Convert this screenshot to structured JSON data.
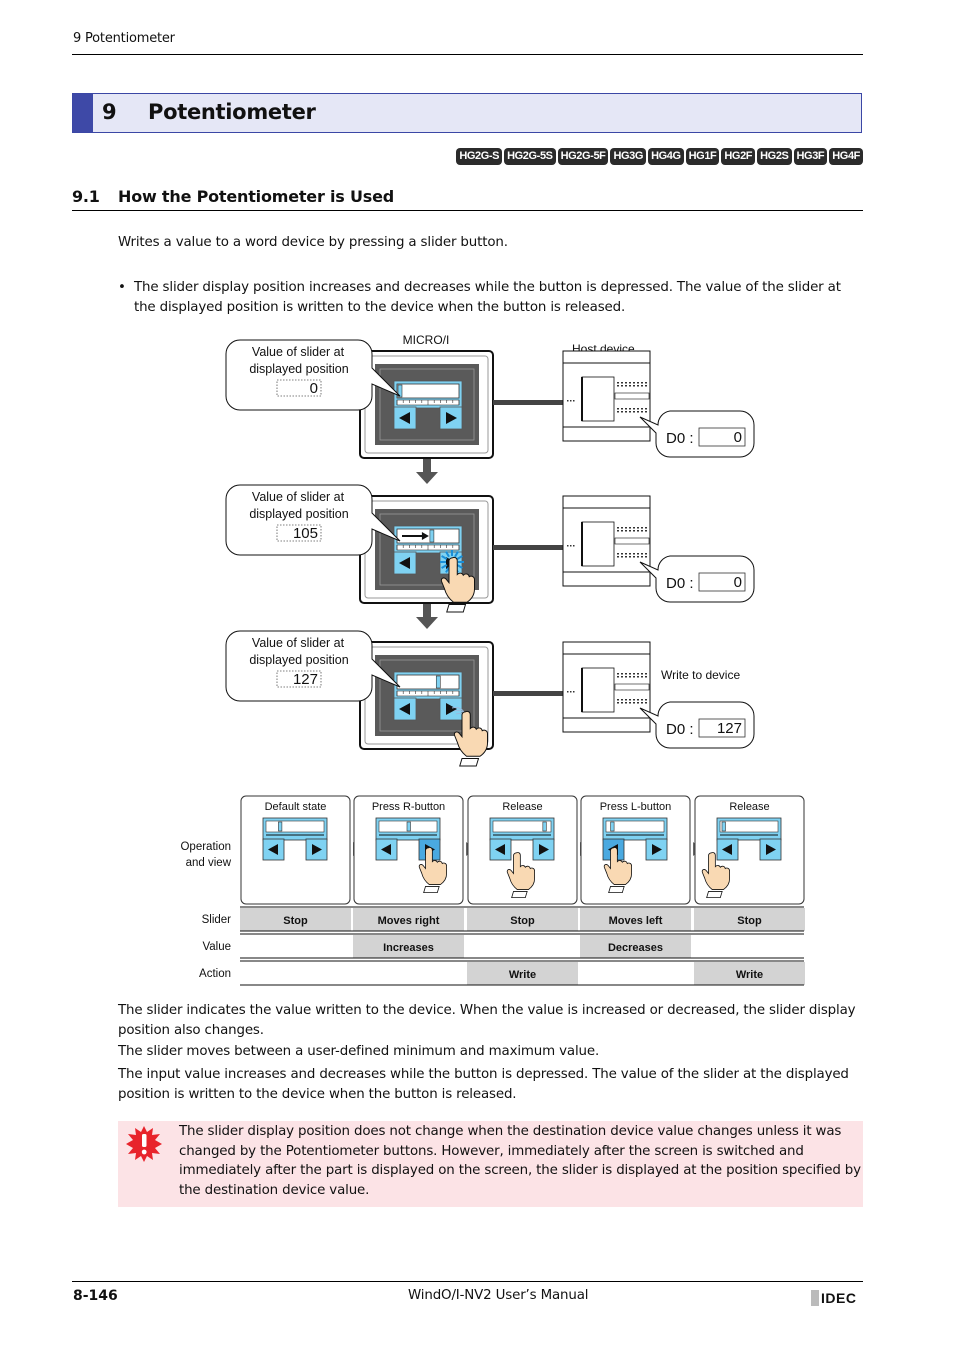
{
  "running_header": "9 Potentiometer",
  "chapter": {
    "number": "9",
    "title": "Potentiometer",
    "accent_color": "#3e49a7",
    "background_color": "#e5e7f6"
  },
  "models": [
    "HG2G-S",
    "HG2G-5S",
    "HG2G-5F",
    "HG3G",
    "HG4G",
    "HG1F",
    "HG2F",
    "HG2S",
    "HG3F",
    "HG4F"
  ],
  "section": {
    "number": "9.1",
    "title": "How the Potentiometer is Used"
  },
  "intro": "Writes a value to a word device by pressing a slider button.",
  "bullet": {
    "marker": "•",
    "text": "The slider display position increases and decreases while the button is depressed. The value of the slider at the displayed position is written to the device when the button is released."
  },
  "figure1": {
    "micro_label": "MICRO/I",
    "host_label": "Host device",
    "write_label": "Write to device",
    "steps": [
      {
        "callout": [
          "Value of slider at",
          "displayed position"
        ],
        "slider_value": "0",
        "device_label": "D0 :",
        "device_value": "0",
        "slider_fraction": 0.0
      },
      {
        "callout": [
          "Value of slider at",
          "displayed position"
        ],
        "slider_value": "105",
        "device_label": "D0 :",
        "device_value": "0",
        "slider_fraction": 0.55
      },
      {
        "callout": [
          "Value of slider at",
          "displayed position"
        ],
        "slider_value": "127",
        "device_label": "D0 :",
        "device_value": "127",
        "slider_fraction": 0.66
      }
    ]
  },
  "figure2": {
    "row_label_operation": [
      "Operation",
      "and view"
    ],
    "row_labels": [
      "Slider",
      "Value",
      "Action"
    ],
    "columns": [
      {
        "title": "Default state",
        "slider": "Stop",
        "value": "",
        "action": "",
        "slider_fraction": 0.2,
        "pressed": "none",
        "hand": "none"
      },
      {
        "title": "Press R-button",
        "slider": "Moves right",
        "value": "Increases",
        "action": "",
        "slider_fraction": 0.5,
        "pressed": "right",
        "hand": "right"
      },
      {
        "title": "Release",
        "slider": "Stop",
        "value": "",
        "action": "Write",
        "slider_fraction": 0.92,
        "pressed": "none",
        "hand": "right-release"
      },
      {
        "title": "Press L-button",
        "slider": "Moves left",
        "value": "Decreases",
        "action": "",
        "slider_fraction": 0.05,
        "pressed": "left",
        "hand": "left"
      },
      {
        "title": "Release",
        "slider": "Stop",
        "value": "",
        "action": "Write",
        "slider_fraction": 0.0,
        "pressed": "none",
        "hand": "left-release"
      }
    ]
  },
  "paragraphs": [
    "The slider indicates the value written to the device. When the value is increased or decreased, the slider display position also changes.",
    "The slider moves between a user-defined minimum and maximum value.",
    "The input value increases and decreases while the button is depressed. The value of the slider at the displayed position is written to the device when the button is released."
  ],
  "note": {
    "icon": "warning-burst-icon",
    "text": "The slider display position does not change when the destination device value changes unless it was changed by the Potentiometer buttons. However, immediately after the screen is switched and immediately after the part is displayed on the screen, the slider is displayed at the position specified by the destination device value.",
    "background_color": "#fce3e6"
  },
  "footer": {
    "page": "8-146",
    "title": "WindO/I-NV2 User’s Manual",
    "logo": "IDEC"
  },
  "colors": {
    "button_blue": "#7fd2f2",
    "button_pressed": "#4aa9e0",
    "panel_dark": "#5a5a5a",
    "table_gray": "#d3d3d3",
    "hand_fill": "#f9d9b3"
  }
}
